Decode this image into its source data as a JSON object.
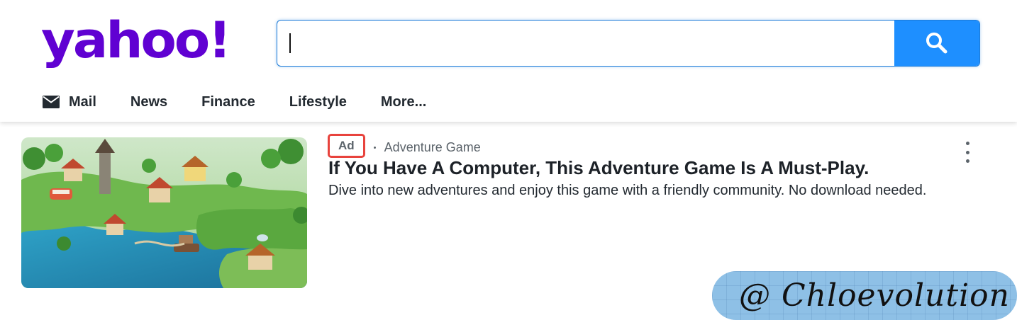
{
  "header": {
    "logo_text": "yahoo!",
    "brand_color": "#6001d2",
    "search": {
      "value": "",
      "placeholder": "",
      "button_icon": "search-icon",
      "button_color": "#1e8fff"
    },
    "nav": [
      {
        "label": "Mail",
        "icon": "mail-icon"
      },
      {
        "label": "News"
      },
      {
        "label": "Finance"
      },
      {
        "label": "Lifestyle"
      },
      {
        "label": "More..."
      }
    ]
  },
  "ad": {
    "badge": "Ad",
    "badge_highlight_color": "#e8433d",
    "source": "Adventure Game",
    "title": "If You Have A Computer, This Adventure Game Is A Must-Play.",
    "description": "Dive into new adventures and enjoy this game with a friendly community. No download needed.",
    "menu_icon": "kebab-menu-icon"
  },
  "watermark": {
    "text": "@ Chloevolution"
  }
}
